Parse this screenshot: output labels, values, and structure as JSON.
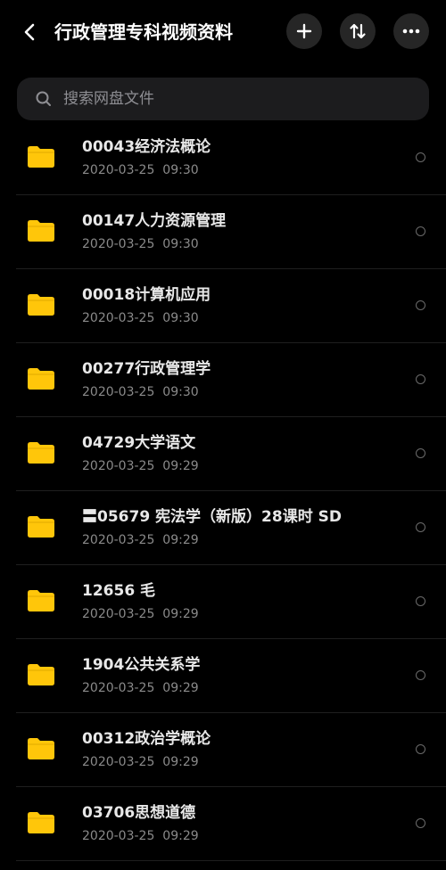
{
  "header": {
    "title": "行政管理专科视频资料",
    "back_icon": "chevron-left-icon",
    "add_icon": "plus-icon",
    "sort_icon": "sort-icon",
    "more_icon": "more-horizontal-icon"
  },
  "search": {
    "placeholder": "搜索网盘文件",
    "icon": "search-icon"
  },
  "colors": {
    "background": "#000000",
    "folder": "#FFC60A",
    "button_bg": "#262626",
    "search_bg": "#1C1C1E"
  },
  "files": [
    {
      "name": "00043经济法概论",
      "date": "2020-03-25",
      "time": "09:30"
    },
    {
      "name": "00147人力资源管理",
      "date": "2020-03-25",
      "time": "09:30"
    },
    {
      "name": "00018计算机应用",
      "date": "2020-03-25",
      "time": "09:30"
    },
    {
      "name": "00277行政管理学",
      "date": "2020-03-25",
      "time": "09:30"
    },
    {
      "name": "04729大学语文",
      "date": "2020-03-25",
      "time": "09:29"
    },
    {
      "name": "〓05679 宪法学（新版）28课时 SD",
      "date": "2020-03-25",
      "time": "09:29"
    },
    {
      "name": "12656 毛",
      "date": "2020-03-25",
      "time": "09:29"
    },
    {
      "name": "1904公共关系学",
      "date": "2020-03-25",
      "time": "09:29"
    },
    {
      "name": "00312政治学概论",
      "date": "2020-03-25",
      "time": "09:29"
    },
    {
      "name": "03706思想道德",
      "date": "2020-03-25",
      "time": "09:29"
    }
  ]
}
